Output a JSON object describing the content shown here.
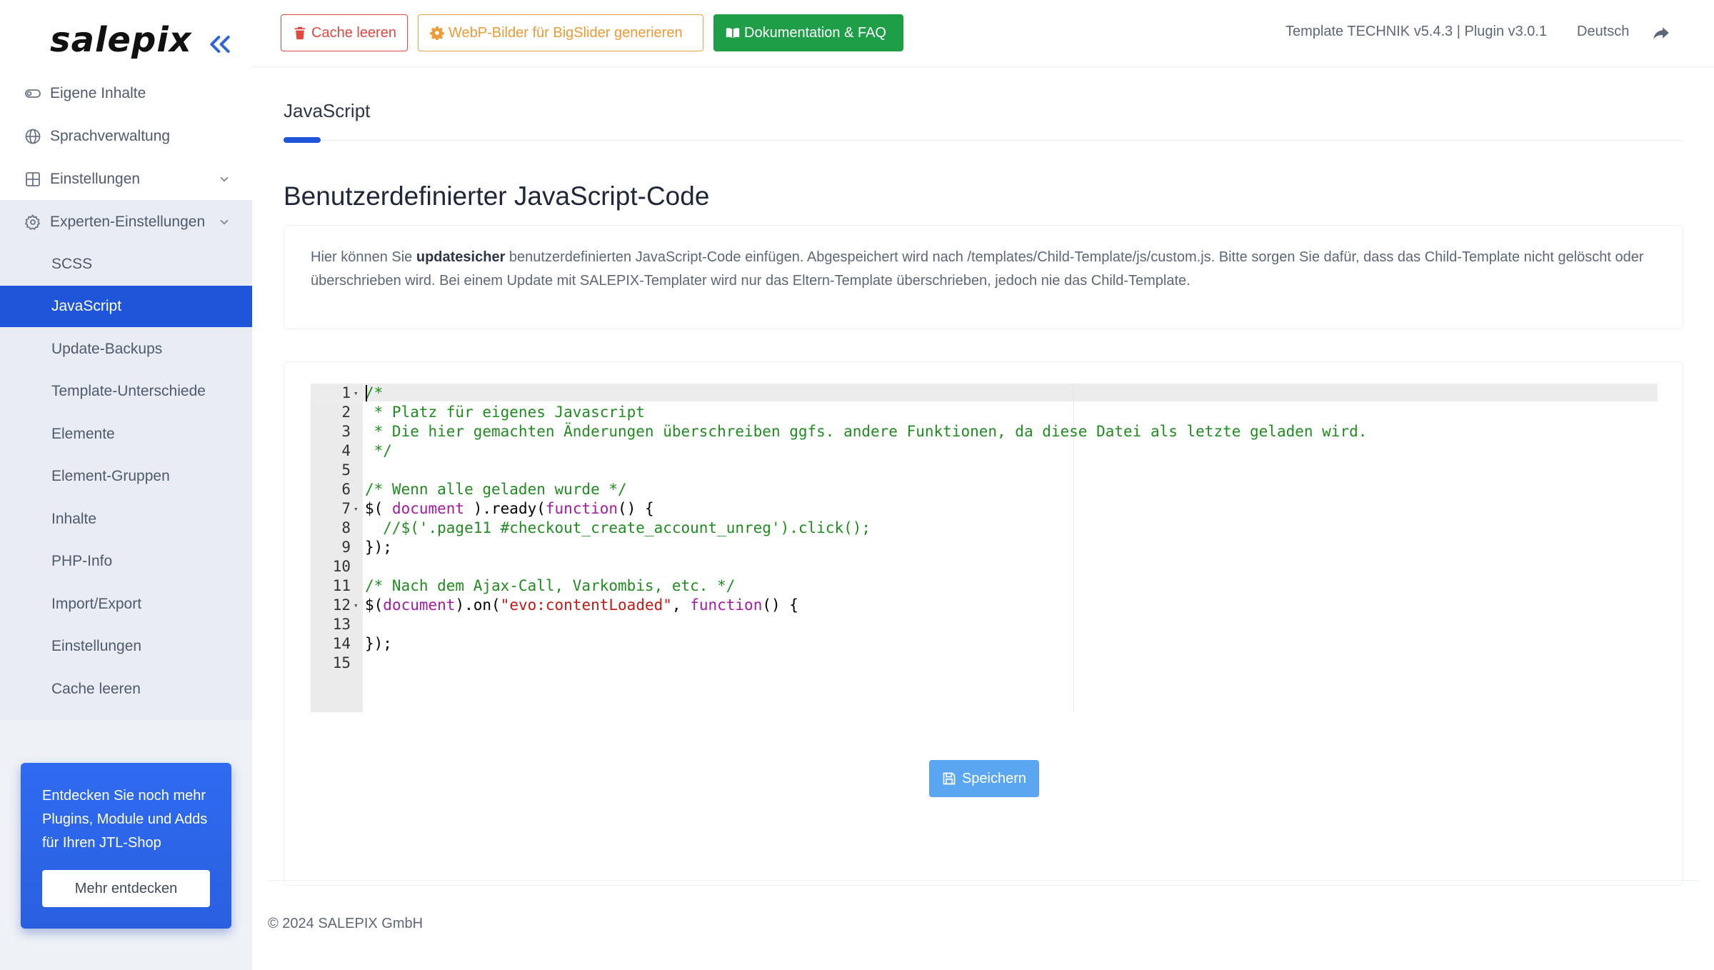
{
  "sidebar": {
    "logo": "salepix",
    "items": [
      {
        "label": "Eigene Inhalte",
        "icon": "toggle-icon"
      },
      {
        "label": "Sprachverwaltung",
        "icon": "globe-icon"
      },
      {
        "label": "Einstellungen",
        "icon": "grid-icon"
      },
      {
        "label": "Experten-Einstellungen",
        "icon": "gear-icon"
      }
    ],
    "subitems": [
      "SCSS",
      "JavaScript",
      "Update-Backups",
      "Template-Unterschiede",
      "Elemente",
      "Element-Gruppen",
      "Inhalte",
      "PHP-Info",
      "Import/Export",
      "Einstellungen",
      "Cache leeren"
    ],
    "active_subitem": "JavaScript",
    "promo": {
      "text": "Entdecken Sie noch mehr Plugins, Module und Adds für Ihren JTL-Shop",
      "button": "Mehr entdecken",
      "color": "#2f6bf0"
    }
  },
  "topbar": {
    "cache_button": "Cache leeren",
    "webp_button": "WebP-Bilder für BigSlider generieren",
    "docs_button": "Dokumentation & FAQ",
    "version": "Template TECHNIK v5.4.3 | Plugin v3.0.1",
    "language": "Deutsch",
    "colors": {
      "danger": "#e0493f",
      "warning": "#f09a35",
      "success": "#1e9e47"
    }
  },
  "main": {
    "tab": "JavaScript",
    "title": "Benutzerdefinierter JavaScript-Code",
    "info": {
      "prefix": "Hier können Sie ",
      "bold": "updatesicher",
      "suffix": " benutzerdefinierten JavaScript-Code einfügen. Abgespeichert wird nach /templates/Child-Template/js/custom.js. Bitte sorgen Sie dafür, dass das Child-Template nicht gelöscht oder überschrieben wird. Bei einem Update mit SALEPIX-Templater wird nur das Eltern-Template überschrieben, jedoch nie das Child-Template."
    },
    "code_lines": [
      {
        "n": "1",
        "fold": true
      },
      {
        "n": "2"
      },
      {
        "n": "3"
      },
      {
        "n": "4"
      },
      {
        "n": "5"
      },
      {
        "n": "6"
      },
      {
        "n": "7",
        "fold": true
      },
      {
        "n": "8"
      },
      {
        "n": "9"
      },
      {
        "n": "10"
      },
      {
        "n": "11"
      },
      {
        "n": "12",
        "fold": true
      },
      {
        "n": "13"
      },
      {
        "n": "14"
      },
      {
        "n": "15"
      }
    ],
    "code": {
      "l1": "/*",
      "l2": " * Platz für eigenes Javascript",
      "l3": " * Die hier gemachten Änderungen überschreiben ggfs. andere Funktionen, da diese Datei als letzte geladen wird.",
      "l4": " */",
      "l6": "/* Wenn alle geladen wurde */",
      "l7a": "$( ",
      "l7b": "document",
      "l7c": " ).ready(",
      "l7d": "function",
      "l7e": "() {",
      "l8": "  //$('.page11 #checkout_create_account_unreg').click();",
      "l9": "});",
      "l11": "/* Nach dem Ajax-Call, Varkombis, etc. */",
      "l12a": "$(",
      "l12b": "document",
      "l12c": ").on(",
      "l12d": "\"evo:contentLoaded\"",
      "l12e": ", ",
      "l12f": "function",
      "l12g": "() {",
      "l14": "});"
    },
    "save_button": "Speichern"
  },
  "footer": {
    "copyright": "© 2024 SALEPIX GmbH"
  }
}
